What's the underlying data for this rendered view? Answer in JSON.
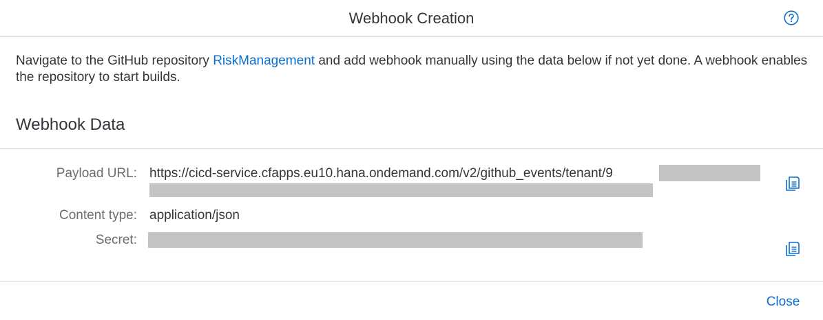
{
  "dialog": {
    "title": "Webhook Creation",
    "help_icon": "question-circle-icon"
  },
  "intro": {
    "before_link": "Navigate to the GitHub repository ",
    "link_text": "RiskManagement",
    "after_link": " and add webhook manually using the data below if not yet done. A webhook enables the repository to start builds."
  },
  "webhook_data": {
    "section_title": "Webhook Data",
    "payload_url": {
      "label": "Payload URL:",
      "value": "https://cicd-service.cfapps.eu10.hana.ondemand.com/v2/github_events/tenant/9"
    },
    "content_type": {
      "label": "Content type:",
      "value": "application/json"
    },
    "secret": {
      "label": "Secret:"
    },
    "copy_icon": "copy-icon"
  },
  "footer": {
    "close_label": "Close"
  },
  "colors": {
    "accent": "#0a6ed1",
    "text": "#32363a",
    "label": "#6a6d70",
    "redaction": "#c4c4c4",
    "divider": "#d9d9d9"
  }
}
